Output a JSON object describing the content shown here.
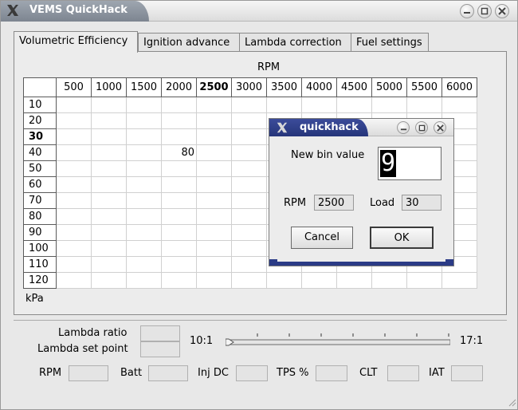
{
  "window": {
    "title": "VEMS QuickHack"
  },
  "tabs": [
    {
      "label": "Volumetric Efficiency",
      "active": true
    },
    {
      "label": "Ignition advance",
      "active": false
    },
    {
      "label": "Lambda correction",
      "active": false
    },
    {
      "label": "Fuel settings",
      "active": false
    }
  ],
  "table": {
    "x_axis_label": "RPM",
    "y_axis_label": "kPa",
    "rpm_columns": [
      "500",
      "1000",
      "1500",
      "2000",
      "2500",
      "3000",
      "3500",
      "4000",
      "4500",
      "5000",
      "5500",
      "6000"
    ],
    "load_rows": [
      "10",
      "20",
      "30",
      "40",
      "50",
      "60",
      "70",
      "80",
      "90",
      "100",
      "110",
      "120"
    ],
    "highlight_column": "2500",
    "highlight_row": "30",
    "cells": [
      {
        "row": "40",
        "col": "2000",
        "value": "80"
      }
    ]
  },
  "bottom": {
    "lambda_ratio_label": "Lambda ratio",
    "lambda_set_point_label": "Lambda set point",
    "slider_min_label": "10:1",
    "slider_max_label": "17:1",
    "slider_value": 10,
    "gauges": [
      "RPM",
      "Batt",
      "Inj DC",
      "TPS %",
      "CLT",
      "IAT"
    ]
  },
  "dialog": {
    "title": "quickhack",
    "prompt_label": "New bin value",
    "input_value": "9",
    "rpm_label": "RPM",
    "rpm_value": "2500",
    "load_label": "Load",
    "load_value": "30",
    "cancel_label": "Cancel",
    "ok_label": "OK"
  },
  "colors": {
    "dialog_title": "#2b3b86",
    "window_title": "#8c949e"
  }
}
